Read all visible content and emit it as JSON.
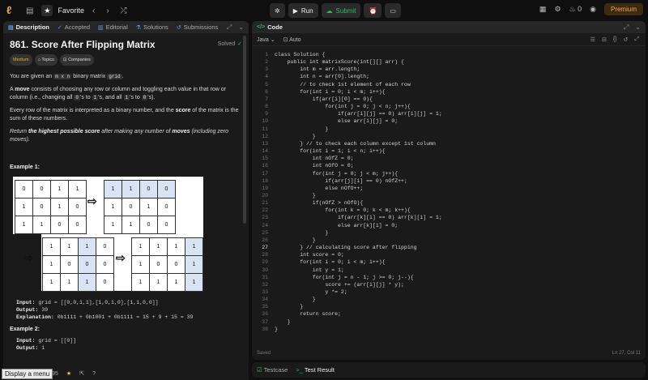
{
  "topbar": {
    "favorite_label": "Favorite",
    "run_label": "Run",
    "submit_label": "Submit",
    "notif_count": "0",
    "premium_label": "Premium"
  },
  "left_tabs": [
    {
      "label": "Description",
      "icon": "document-icon"
    },
    {
      "label": "Accepted",
      "icon": "check-icon"
    },
    {
      "label": "Editorial",
      "icon": "book-icon"
    },
    {
      "label": "Solutions",
      "icon": "flask-icon"
    },
    {
      "label": "Submissions",
      "icon": "history-icon"
    }
  ],
  "problem": {
    "title": "861. Score After Flipping Matrix",
    "status": "Solved",
    "difficulty": "Medium",
    "topics_label": "Topics",
    "companies_label": "Companies",
    "p1_pre": "You are given an ",
    "p1_code1": "m x n",
    "p1_post": " binary matrix ",
    "p1_code2": "grid",
    "p1_end": ".",
    "p2_a": "A ",
    "p2_b": "move",
    "p2_c": " consists of choosing any row or column and toggling each value in that row or column (i.e., changing all ",
    "p2_d": "0",
    "p2_e": "'s to ",
    "p2_f": "1",
    "p2_g": "'s, and all ",
    "p2_h": "1",
    "p2_i": "'s to ",
    "p2_j": "0",
    "p2_k": "'s).",
    "p3_a": "Every row of the matrix is interpreted as a binary number, and the ",
    "p3_b": "score",
    "p3_c": " of the matrix is the sum of these numbers.",
    "p4_a": "Return ",
    "p4_b": "the highest possible ",
    "p4_c": "score",
    "p4_d": " after making any number of ",
    "p4_e": "moves",
    "p4_f": " (including zero moves)",
    "p4_g": ".",
    "example1_title": "Example 1:",
    "ex1_input_label": "Input:",
    "ex1_input": "grid = [[0,0,1,1],[1,0,1,0],[1,1,0,0]]",
    "ex1_output_label": "Output:",
    "ex1_output": "39",
    "ex1_expl_label": "Explanation:",
    "ex1_expl": "0b1111 + 0b1001 + 0b1111 = 15 + 9 + 15 = 39",
    "example2_title": "Example 2:",
    "ex2_input_label": "Input:",
    "ex2_input": "grid = [[0]]",
    "ex2_output_label": "Output:",
    "ex2_output": "1"
  },
  "example_figure": {
    "grid_a": [
      [
        "0",
        "0",
        "1",
        "1"
      ],
      [
        "1",
        "0",
        "1",
        "0"
      ],
      [
        "1",
        "1",
        "0",
        "0"
      ]
    ],
    "grid_b": [
      [
        "1",
        "1",
        "0",
        "0"
      ],
      [
        "1",
        "0",
        "1",
        "0"
      ],
      [
        "1",
        "1",
        "0",
        "0"
      ]
    ],
    "grid_c": [
      [
        "1",
        "1",
        "1",
        "0"
      ],
      [
        "1",
        "0",
        "0",
        "0"
      ],
      [
        "1",
        "1",
        "1",
        "0"
      ]
    ],
    "grid_d": [
      [
        "1",
        "1",
        "1",
        "1"
      ],
      [
        "1",
        "0",
        "0",
        "1"
      ],
      [
        "1",
        "1",
        "1",
        "1"
      ]
    ]
  },
  "footer": {
    "count": "95",
    "tooltip": "Display a menu"
  },
  "code_panel": {
    "title": "Code",
    "language": "Java",
    "mode": "Auto",
    "status_left": "Saved",
    "cursor": "Ln 27, Col 11",
    "current_line": 27,
    "lines": [
      "class Solution {",
      "    public int matrixScore(int[][] arr) {",
      "        int m = arr.length;",
      "        int n = arr[0].length;",
      "        // to check 1st element of each row",
      "        for(int i = 0; i < m; i++){",
      "            if(arr[i][0] == 0){",
      "                for(int j = 0; j < n; j++){",
      "                    if(arr[i][j] == 0) arr[i][j] = 1;",
      "                    else arr[i][j] = 0;",
      "                }",
      "            }",
      "        } // to check each column except 1st column",
      "        for(int i = 1; i < n; i++){",
      "            int nOfZ = 0;",
      "            int nOfO = 0;",
      "            for(int j = 0; j < m; j++){",
      "                if(arr[j][i] == 0) nOfZ++;",
      "                else nOfO++;",
      "            }",
      "            if(nOfZ > nOfO){",
      "                for(int k = 0; k < m; k++){",
      "                    if(arr[k][i] == 0) arr[k][i] = 1;",
      "                    else arr[k][i] = 0;",
      "                }",
      "            }",
      "        } // calculating score after flipping",
      "        int score = 0;",
      "        for(int i = 0; i < m; i++){",
      "            int y = 1;",
      "            for(int j = n - 1; j >= 0; j--){",
      "                score += (arr[i][j] * y);",
      "                y *= 2;",
      "            }",
      "        }",
      "        return score;",
      "    }",
      "}"
    ]
  },
  "bottom_tabs": {
    "testcase": "Testcase",
    "result": "Test Result"
  }
}
